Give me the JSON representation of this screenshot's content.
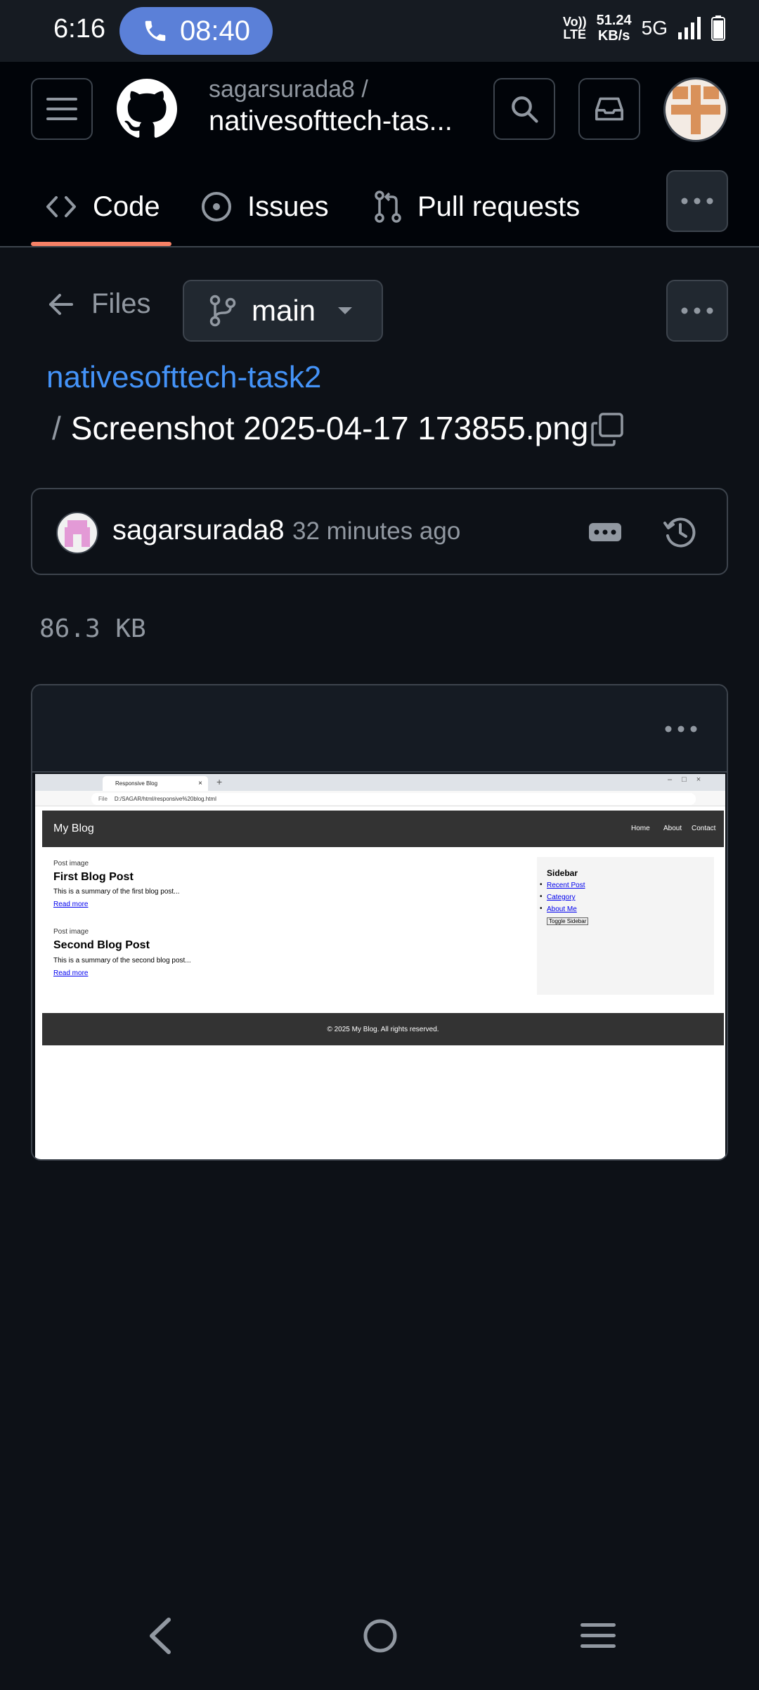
{
  "status_bar": {
    "time": "6:16",
    "call_timer": "08:40",
    "volte_line1": "Vo))",
    "volte_line2": "LTE",
    "speed_value": "51.24",
    "speed_unit": "KB/s",
    "network": "5G"
  },
  "header": {
    "owner": "sagarsurada8 /",
    "repo": "nativesofttech-tas..."
  },
  "tabs": [
    {
      "label": "Code"
    },
    {
      "label": "Issues"
    },
    {
      "label": "Pull requests"
    }
  ],
  "files": {
    "back_label": "Files",
    "branch": "main"
  },
  "breadcrumb": {
    "repo": "nativesofttech-task2",
    "separator": "/",
    "file": "Screenshot 2025-04-17 173855.png"
  },
  "commit": {
    "author": "sagarsurada8",
    "time": "32 minutes ago"
  },
  "file_size": "86.3 KB",
  "preview": {
    "tab_title": "Responsive Blog",
    "address_prefix": "File",
    "address": "D:/SAGAR/html/responsive%20blog.html",
    "site_title": "My Blog",
    "nav": [
      "Home",
      "About",
      "Contact"
    ],
    "posts": [
      {
        "alt": "Post image",
        "title": "First Blog Post",
        "summary": "This is a summary of the first blog post...",
        "link": "Read more"
      },
      {
        "alt": "Post image",
        "title": "Second Blog Post",
        "summary": "This is a summary of the second blog post...",
        "link": "Read more"
      }
    ],
    "sidebar": {
      "title": "Sidebar",
      "links": [
        "Recent Post",
        "Category",
        "About Me"
      ],
      "button": "Toggle Sidebar"
    },
    "footer": "© 2025 My Blog. All rights reserved."
  },
  "colors": {
    "accent_link": "#4493f8",
    "tab_underline": "#f78166",
    "call_pill": "#5b80d8"
  }
}
